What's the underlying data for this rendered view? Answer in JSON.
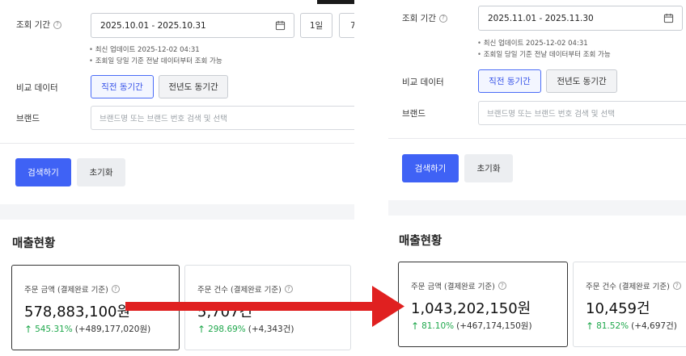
{
  "left": {
    "period_label": "조회 기간",
    "date_range": "2025.10.01 - 2025.10.31",
    "quick_btn_1": "1일",
    "quick_btn_2": "7",
    "notes": [
      "최신 업데이트 2025-12-02 04:31",
      "조회일 당일 기준 전날 데이터부터 조회 가능"
    ],
    "compare_label": "비교 데이터",
    "compare_prev": "직전 동기간",
    "compare_yoy": "전년도 동기간",
    "brand_label": "브랜드",
    "brand_placeholder": "브랜드명 또는 브랜드 번호 검색 및 선택",
    "search_btn": "검색하기",
    "reset_btn": "초기화",
    "section_title": "매출현황",
    "card1": {
      "label": "주문 금액 (결제완료 기준)",
      "value": "578,883,100원",
      "pct": "545.31%",
      "abs": "(+489,177,020원)"
    },
    "card2": {
      "label": "주문 건수 (결제완료 기준)",
      "value": "5,707건",
      "pct": "298.69%",
      "abs": "(+4,343건)"
    }
  },
  "right": {
    "period_label": "조회 기간",
    "date_range": "2025.11.01 - 2025.11.30",
    "notes": [
      "최신 업데이트 2025-12-02 04:31",
      "조회일 당일 기준 전날 데이터부터 조회 가능"
    ],
    "compare_label": "비교 데이터",
    "compare_prev": "직전 동기간",
    "compare_yoy": "전년도 동기간",
    "brand_label": "브랜드",
    "brand_placeholder": "브랜드명 또는 브랜드 번호 검색 및 선택",
    "search_btn": "검색하기",
    "reset_btn": "초기화",
    "section_title": "매출현황",
    "card1": {
      "label": "주문 금액 (결제완료 기준)",
      "value": "1,043,202,150원",
      "pct": "81.10%",
      "abs": "(+467,174,150원)"
    },
    "card2": {
      "label": "주문 건수 (결제완료 기준)",
      "value": "10,459건",
      "pct": "81.52%",
      "abs": "(+4,697건)"
    }
  },
  "icons": {
    "help": "?",
    "calendar": "calendar-icon",
    "up_arrow": "↑"
  },
  "colors": {
    "accent": "#3f62f5",
    "positive": "#1fa84c",
    "arrow": "#e02020"
  }
}
